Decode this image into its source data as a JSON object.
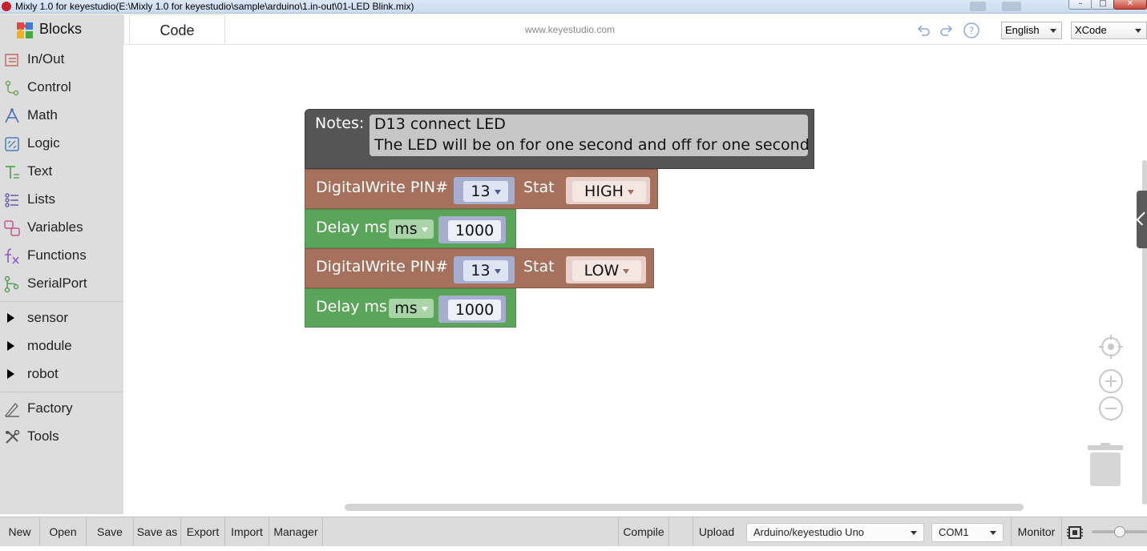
{
  "window": {
    "title": "Mixly 1.0 for keyestudio(E:\\Mixly 1.0 for keyestudio\\sample\\arduino\\1.in-out\\01-LED Blink.mix)",
    "close_glyph": "✕",
    "minimize_glyph": "–",
    "maximize_glyph": "□"
  },
  "header": {
    "blocks_tab": "Blocks",
    "code_tab": "Code",
    "site": "www.keyestudio.com",
    "language": "English",
    "theme": "XCode"
  },
  "toolbox": {
    "categories": [
      {
        "label": "In/Out",
        "icon": "in-out-icon",
        "color": "#c46a6a"
      },
      {
        "label": "Control",
        "icon": "control-icon",
        "color": "#6aa55a"
      },
      {
        "label": "Math",
        "icon": "math-icon",
        "color": "#4a6fb0"
      },
      {
        "label": "Logic",
        "icon": "logic-icon",
        "color": "#4a7fb0"
      },
      {
        "label": "Text",
        "icon": "text-icon",
        "color": "#5aa55a"
      },
      {
        "label": "Lists",
        "icon": "lists-icon",
        "color": "#6a5aa5"
      },
      {
        "label": "Variables",
        "icon": "variables-icon",
        "color": "#c45a8a"
      },
      {
        "label": "Functions",
        "icon": "functions-icon",
        "color": "#8a5ac4"
      },
      {
        "label": "SerialPort",
        "icon": "serialport-icon",
        "color": "#5a9a5a"
      }
    ],
    "groups": [
      "sensor",
      "module",
      "robot"
    ],
    "extras": [
      {
        "label": "Factory",
        "icon": "factory-icon"
      },
      {
        "label": "Tools",
        "icon": "tools-icon"
      }
    ]
  },
  "blocks": {
    "notes": {
      "label": "Notes:",
      "line1": "D13 connect LED",
      "line2": "The LED will be on for one second and off for one second"
    },
    "write1": {
      "label": "DigitalWrite PIN#",
      "pin": "13",
      "stat_label": "Stat",
      "stat": "HIGH"
    },
    "delay1": {
      "label": "Delay ms",
      "unit": "ms",
      "value": "1000"
    },
    "write2": {
      "label": "DigitalWrite PIN#",
      "pin": "13",
      "stat_label": "Stat",
      "stat": "LOW"
    },
    "delay2": {
      "label": "Delay ms",
      "unit": "ms",
      "value": "1000"
    }
  },
  "colors": {
    "notes_block": "#555555",
    "write_block": "#a5705c",
    "delay_block": "#5ba55b",
    "toolbox_bg": "#dddddd"
  },
  "bottombar": {
    "new": "New",
    "open": "Open",
    "save": "Save",
    "save_as": "Save as",
    "export": "Export",
    "import": "Import",
    "manager": "Manager",
    "compile": "Compile",
    "upload": "Upload",
    "board": "Arduino/keyestudio Uno",
    "port": "COM1",
    "monitor": "Monitor"
  }
}
